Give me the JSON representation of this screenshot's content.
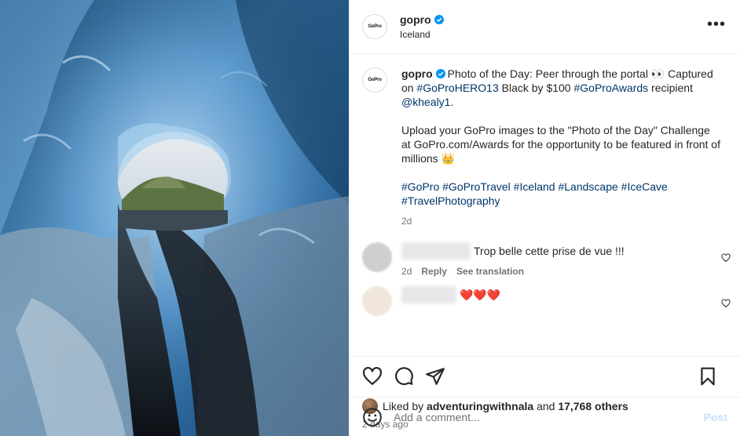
{
  "header": {
    "username": "gopro",
    "location": "Iceland",
    "avatar_text": "GoPro",
    "more_icon": "more-horizontal-icon"
  },
  "caption": {
    "username": "gopro",
    "line1_a": "Photo of the Day: Peer through the portal 👀 Captured on ",
    "tag1": "#GoProHERO13",
    "line1_b": " Black by $100 ",
    "tag2": "#GoProAwards",
    "line1_c": " recipient ",
    "mention": "@khealy1",
    "line1_d": ".",
    "para2": "Upload your GoPro images to the \"Photo of the Day\" Challenge at GoPro.com/Awards for the opportunity to be featured in front of millions 👑",
    "hashtags": [
      "#GoPro",
      "#GoProTravel",
      "#Iceland",
      "#Landscape",
      "#IceCave",
      "#TravelPhotography"
    ],
    "age": "2d"
  },
  "comments": [
    {
      "text": "Trop belle cette prise de vue !!!",
      "age": "2d",
      "reply": "Reply",
      "translate": "See translation"
    },
    {
      "text": "❤️❤️❤️"
    }
  ],
  "likes": {
    "prefix": "Liked by",
    "user": "adventuringwithnala",
    "and": "and",
    "others": "17,768 others"
  },
  "time": "2 days ago",
  "add_comment": {
    "placeholder": "Add a comment...",
    "post_label": "Post"
  },
  "colors": {
    "link": "#00376b",
    "verified": "#0095f6",
    "post_disabled": "#c5e1fb"
  }
}
